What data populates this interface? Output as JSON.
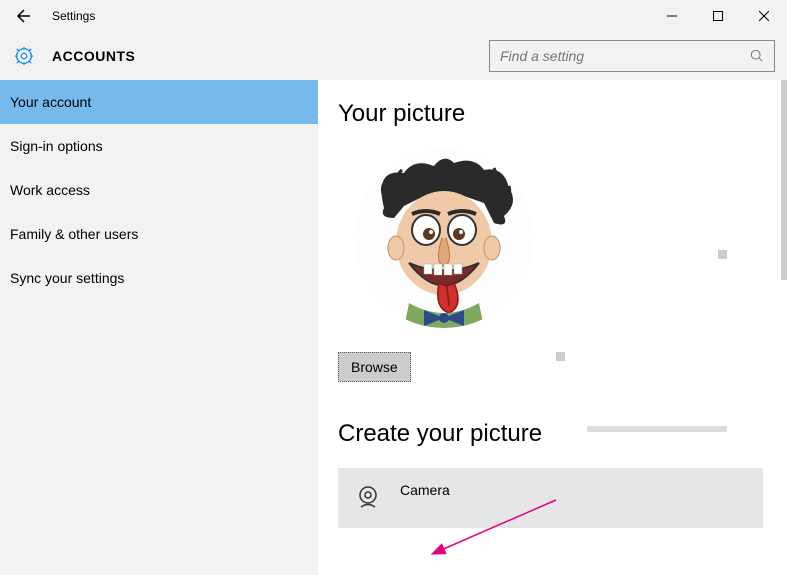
{
  "window": {
    "title": "Settings"
  },
  "header": {
    "title": "ACCOUNTS",
    "search_placeholder": "Find a setting"
  },
  "sidebar": {
    "items": [
      {
        "label": "Your account",
        "active": true
      },
      {
        "label": "Sign-in options",
        "active": false
      },
      {
        "label": "Work access",
        "active": false
      },
      {
        "label": "Family & other users",
        "active": false
      },
      {
        "label": "Sync your settings",
        "active": false
      }
    ]
  },
  "main": {
    "picture_heading": "Your picture",
    "browse_label": "Browse",
    "create_heading": "Create your picture",
    "camera_label": "Camera"
  }
}
